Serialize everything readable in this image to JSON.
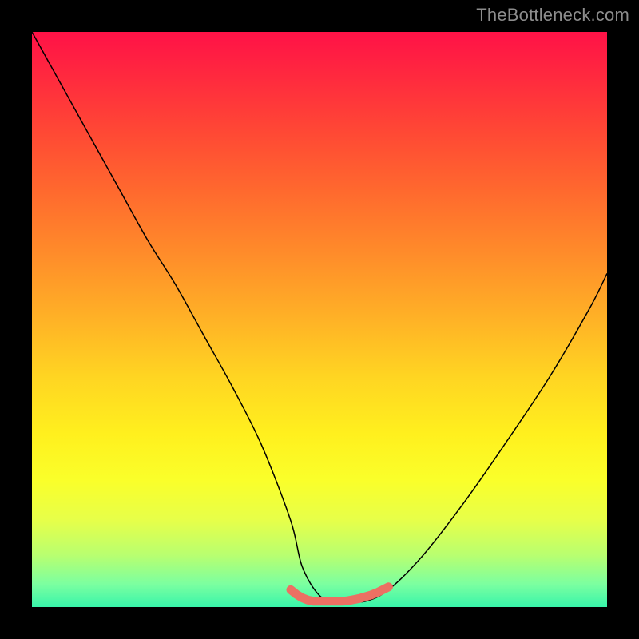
{
  "watermark": {
    "text": "TheBottleneck.com"
  },
  "chart_data": {
    "type": "line",
    "title": "",
    "xlabel": "",
    "ylabel": "",
    "xlim": [
      0,
      100
    ],
    "ylim": [
      0,
      100
    ],
    "grid": false,
    "series": [
      {
        "name": "black-curve",
        "color": "#000000",
        "width": 1.5,
        "x": [
          0,
          5,
          10,
          15,
          20,
          25,
          30,
          35,
          40,
          45,
          47,
          50,
          53,
          55,
          58,
          62,
          68,
          75,
          82,
          90,
          97,
          100
        ],
        "y": [
          100,
          91,
          82,
          73,
          64,
          56,
          47,
          38,
          28,
          15,
          7,
          2,
          1,
          1,
          1,
          3,
          9,
          18,
          28,
          40,
          52,
          58
        ]
      },
      {
        "name": "red-valley-marker",
        "color": "#ec7063",
        "width": 11,
        "cap": "round",
        "x": [
          45,
          46,
          47,
          48,
          49,
          50,
          51,
          52,
          53,
          54,
          55,
          56,
          57,
          58,
          59,
          60,
          61,
          62
        ],
        "y": [
          3,
          2.2,
          1.6,
          1.2,
          1.0,
          1.0,
          1.0,
          1.0,
          1.0,
          1.0,
          1.1,
          1.3,
          1.5,
          1.8,
          2.1,
          2.5,
          3.0,
          3.5
        ]
      }
    ],
    "legend": false
  }
}
